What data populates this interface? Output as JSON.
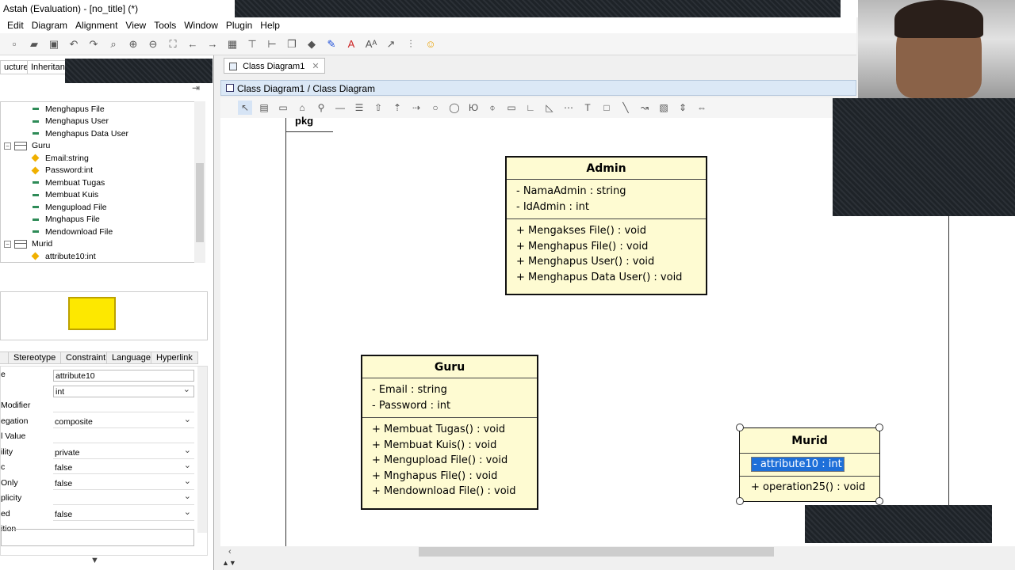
{
  "window": {
    "title": "Astah (Evaluation) - [no_title] (*)"
  },
  "menu": [
    "Edit",
    "Diagram",
    "Alignment",
    "View",
    "Tools",
    "Window",
    "Plugin",
    "Help"
  ],
  "left_tabs": {
    "structure": "ucture",
    "inheritance": "Inheritan"
  },
  "tree": [
    {
      "kind": "op",
      "label": "Menghapus File"
    },
    {
      "kind": "op",
      "label": "Menghapus User"
    },
    {
      "kind": "op",
      "label": "Menghapus Data User"
    },
    {
      "kind": "class",
      "label": "Guru"
    },
    {
      "kind": "attr",
      "label": "Email:string"
    },
    {
      "kind": "attr",
      "label": "Password:int"
    },
    {
      "kind": "op",
      "label": "Membuat Tugas"
    },
    {
      "kind": "op",
      "label": "Membuat Kuis"
    },
    {
      "kind": "op",
      "label": "Mengupload File"
    },
    {
      "kind": "op",
      "label": "Mnghapus File"
    },
    {
      "kind": "op",
      "label": "Mendownload File"
    },
    {
      "kind": "class",
      "label": "Murid"
    },
    {
      "kind": "attr",
      "label": "attribute10:int"
    }
  ],
  "prop_tabs": [
    "Stereotype",
    "Constraint",
    "Language",
    "Hyperlink"
  ],
  "properties": [
    {
      "label": "e",
      "value": "attribute10",
      "dropdown": false
    },
    {
      "label": "",
      "value": "int",
      "dropdown": true
    },
    {
      "label": "Modifier",
      "value": "",
      "dropdown": false
    },
    {
      "label": "egation",
      "value": "composite",
      "dropdown": true
    },
    {
      "label": "l Value",
      "value": "",
      "dropdown": false
    },
    {
      "label": "ility",
      "value": "private",
      "dropdown": true
    },
    {
      "label": "c",
      "value": "false",
      "dropdown": true
    },
    {
      "label": "Only",
      "value": "false",
      "dropdown": true
    },
    {
      "label": "plicity",
      "value": "",
      "dropdown": true
    },
    {
      "label": "ed",
      "value": "false",
      "dropdown": true
    },
    {
      "label": "ition",
      "value": "",
      "dropdown": false
    }
  ],
  "diagram": {
    "tab_label": "Class Diagram1",
    "breadcrumb": "Class Diagram1 / Class Diagram",
    "package_label": "pkg",
    "classes": {
      "admin": {
        "name": "Admin",
        "attributes": [
          "- NamaAdmin : string",
          "- IdAdmin : int"
        ],
        "operations": [
          "+ Mengakses File() : void",
          "+ Menghapus File() : void",
          "+ Menghapus User() : void",
          "+ Menghapus Data User() : void"
        ]
      },
      "guru": {
        "name": "Guru",
        "attributes": [
          "- Email : string",
          "- Password : int"
        ],
        "operations": [
          "+ Membuat Tugas() : void",
          "+ Membuat Kuis() : void",
          "+ Mengupload File() : void",
          "+ Mnghapus File() : void",
          "+ Mendownload File() : void"
        ]
      },
      "murid": {
        "name": "Murid",
        "attributes": [
          "- attribute10 : int"
        ],
        "operations": [
          "+ operation25() : void"
        ]
      }
    }
  },
  "colors": {
    "class_fill": "#fefbd2",
    "selection": "#1e6fd9",
    "breadcrumb_bg": "#dbe8f6"
  }
}
